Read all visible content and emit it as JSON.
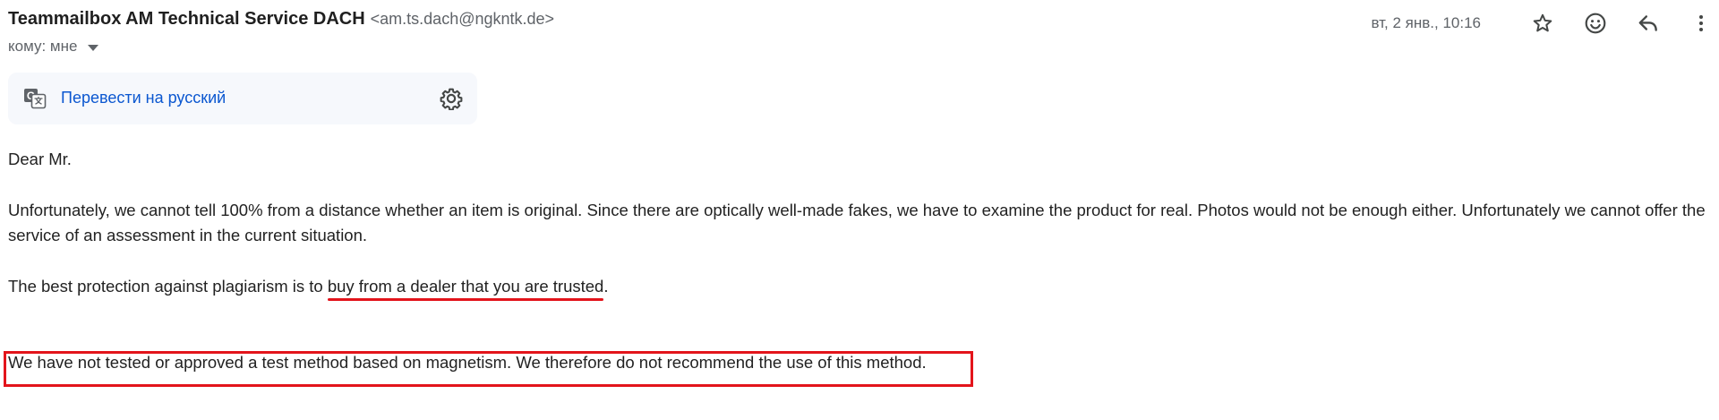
{
  "email": {
    "sender_name": "Teammailbox AM Technical Service DACH",
    "sender_email": "<am.ts.dach@ngkntk.de>",
    "to_label": "кому: мне",
    "date": "вт, 2 янв., 10:16"
  },
  "header_actions": {
    "star_icon": "star-icon",
    "emoji_icon": "emoji-icon",
    "reply_icon": "reply-icon",
    "more_icon": "more-vert-icon"
  },
  "translate": {
    "link_label": "Перевести на русский"
  },
  "body": {
    "greeting": "Dear Mr.",
    "paragraph1": "Unfortunately, we cannot tell 100% from a distance whether an item is original. Since there are optically well-made fakes, we have to examine the product for real. Photos would not be enough either. Unfortunately we cannot offer the service of an assessment in the current situation.",
    "paragraph2_before": "The best protection against plagiarism is to ",
    "paragraph2_highlight": "buy from a dealer that you are trusted",
    "paragraph2_after": ".",
    "paragraph3": "We have not tested or approved a test method based on magnetism. We therefore do not recommend the use of this method."
  },
  "colors": {
    "annotation_red": "#e3141b",
    "link_blue": "#0b57d0",
    "translate_bg": "#f6f8fc"
  }
}
